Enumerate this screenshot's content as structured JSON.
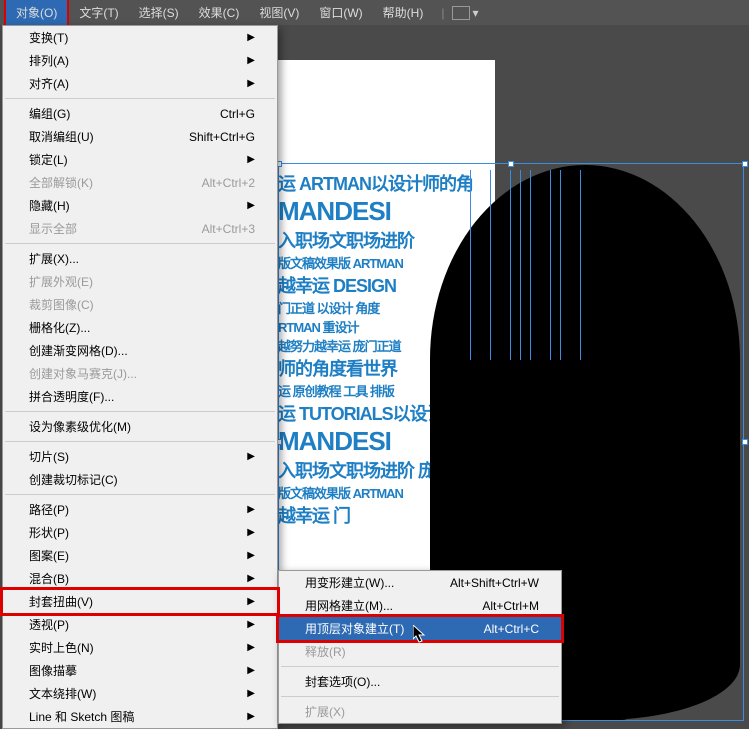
{
  "menubar": {
    "items": [
      "对象(O)",
      "文字(T)",
      "选择(S)",
      "效果(C)",
      "视图(V)",
      "窗口(W)",
      "帮助(H)"
    ]
  },
  "dropdown": {
    "groups": [
      [
        {
          "label": "变换(T)",
          "shortcut": "",
          "sub": true
        },
        {
          "label": "排列(A)",
          "shortcut": "",
          "sub": true
        },
        {
          "label": "对齐(A)",
          "shortcut": "",
          "sub": true
        }
      ],
      [
        {
          "label": "编组(G)",
          "shortcut": "Ctrl+G"
        },
        {
          "label": "取消编组(U)",
          "shortcut": "Shift+Ctrl+G"
        },
        {
          "label": "锁定(L)",
          "shortcut": "",
          "sub": true
        },
        {
          "label": "全部解锁(K)",
          "shortcut": "Alt+Ctrl+2",
          "disabled": true
        },
        {
          "label": "隐藏(H)",
          "shortcut": "",
          "sub": true
        },
        {
          "label": "显示全部",
          "shortcut": "Alt+Ctrl+3",
          "disabled": true
        }
      ],
      [
        {
          "label": "扩展(X)..."
        },
        {
          "label": "扩展外观(E)",
          "disabled": true
        },
        {
          "label": "裁剪图像(C)",
          "disabled": true
        },
        {
          "label": "栅格化(Z)..."
        },
        {
          "label": "创建渐变网格(D)..."
        },
        {
          "label": "创建对象马赛克(J)...",
          "disabled": true
        },
        {
          "label": "拼合透明度(F)..."
        }
      ],
      [
        {
          "label": "设为像素级优化(M)"
        }
      ],
      [
        {
          "label": "切片(S)",
          "sub": true
        },
        {
          "label": "创建裁切标记(C)"
        }
      ],
      [
        {
          "label": "路径(P)",
          "sub": true
        },
        {
          "label": "形状(P)",
          "sub": true
        },
        {
          "label": "图案(E)",
          "sub": true
        },
        {
          "label": "混合(B)",
          "sub": true
        },
        {
          "label": "封套扭曲(V)",
          "sub": true,
          "highlighted": true
        },
        {
          "label": "透视(P)",
          "sub": true
        },
        {
          "label": "实时上色(N)",
          "sub": true
        },
        {
          "label": "图像描摹",
          "sub": true
        },
        {
          "label": "文本绕排(W)",
          "sub": true
        },
        {
          "label": "Line 和 Sketch 图稿",
          "sub": true
        }
      ]
    ]
  },
  "submenu": {
    "items": [
      {
        "label": "用变形建立(W)...",
        "shortcut": "Alt+Shift+Ctrl+W"
      },
      {
        "label": "用网格建立(M)...",
        "shortcut": "Alt+Ctrl+M"
      },
      {
        "label": "用顶层对象建立(T)",
        "shortcut": "Alt+Ctrl+C",
        "selected": true,
        "boxed": true
      },
      {
        "label": "释放(R)",
        "disabled": true
      }
    ],
    "items2": [
      {
        "label": "封套选项(O)..."
      }
    ],
    "items3": [
      {
        "label": "扩展(X)",
        "disabled": true
      }
    ]
  },
  "textcloud": [
    {
      "text": "运 ARTMAN以设计师的角",
      "cls": "med"
    },
    {
      "text": "MANDESI",
      "cls": "big"
    },
    {
      "text": "入职场文职场进阶",
      "cls": "med"
    },
    {
      "text": "版文稿效果版 ARTMAN",
      "cls": "sm"
    },
    {
      "text": "越幸运 DESIGN",
      "cls": "med"
    },
    {
      "text": "门正道 以设计 角度",
      "cls": "sm"
    },
    {
      "text": "RTMAN 重设计",
      "cls": "sm"
    },
    {
      "text": "越努力越幸运 庞门正道",
      "cls": "sm"
    },
    {
      "text": "师的角度看世界",
      "cls": "med"
    },
    {
      "text": "运 原创教程 工具 排版",
      "cls": "sm"
    },
    {
      "text": "运 TUTORIALS以设计师的角",
      "cls": "med"
    },
    {
      "text": "MANDESI",
      "cls": "big"
    },
    {
      "text": "入职场文职场进阶 庞",
      "cls": "med"
    },
    {
      "text": "版文稿效果版 ARTMAN",
      "cls": "sm"
    },
    {
      "text": "越幸运 门",
      "cls": "med"
    }
  ]
}
